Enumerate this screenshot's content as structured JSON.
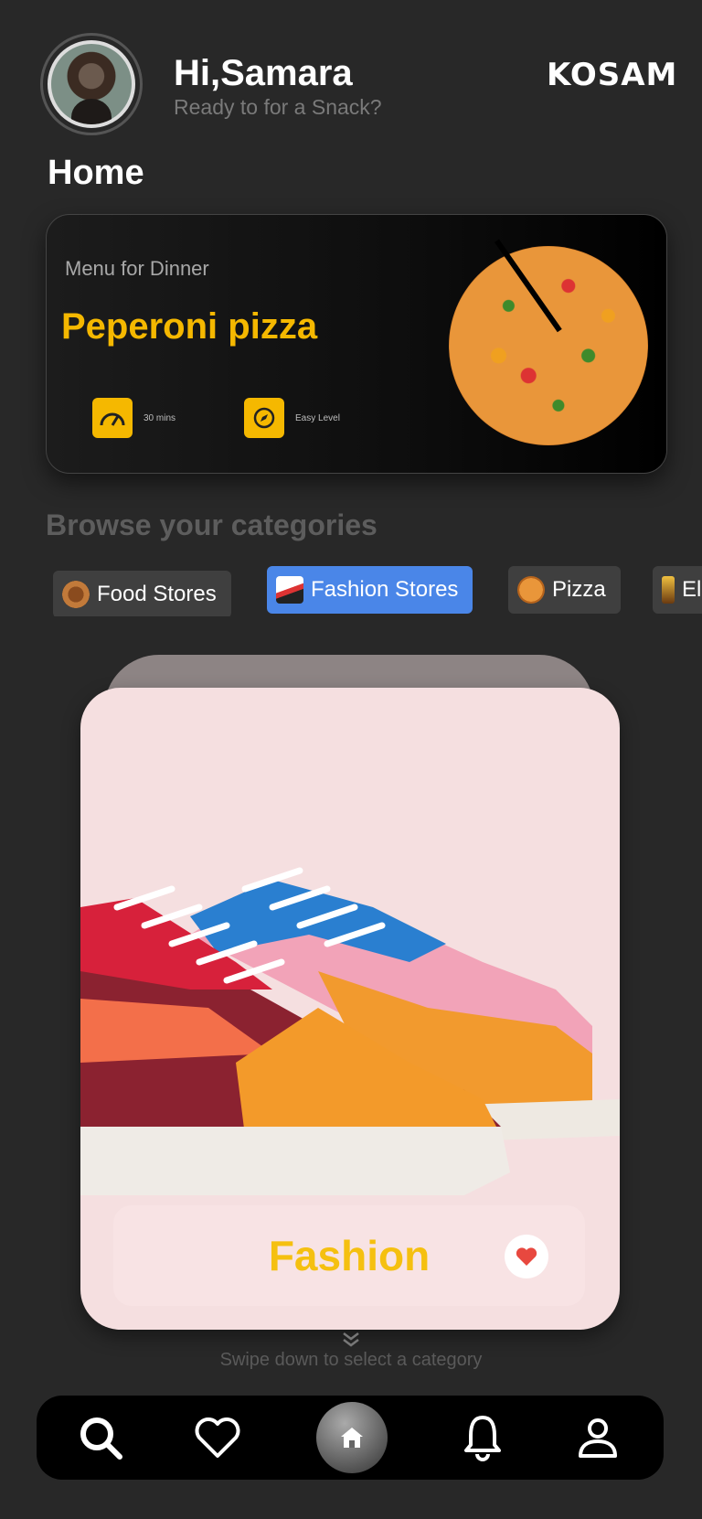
{
  "header": {
    "greeting": "Hi,Samara",
    "subtitle": "Ready to for a Snack?",
    "brand": "KOSAM"
  },
  "page_title": "Home",
  "menu_card": {
    "label": "Menu for Dinner",
    "title": "Peperoni pizza",
    "time": "30 mins",
    "level": "Easy Level",
    "accent_color": "#f5b800"
  },
  "categories": {
    "heading": "Browse your categories",
    "chips": [
      {
        "label": "Food Stores",
        "active": false
      },
      {
        "label": "Fashion Stores",
        "active": true
      },
      {
        "label": "Pizza",
        "active": false
      },
      {
        "label": "El",
        "active": false
      }
    ],
    "active_color": "#4a86e8"
  },
  "category_card": {
    "label": "Fashion",
    "label_color": "#f5c010"
  },
  "swipe_hint": "Swipe down to select a category",
  "nav": {
    "items": [
      "search-icon",
      "heart-icon",
      "home-icon",
      "bell-icon",
      "user-icon"
    ]
  }
}
